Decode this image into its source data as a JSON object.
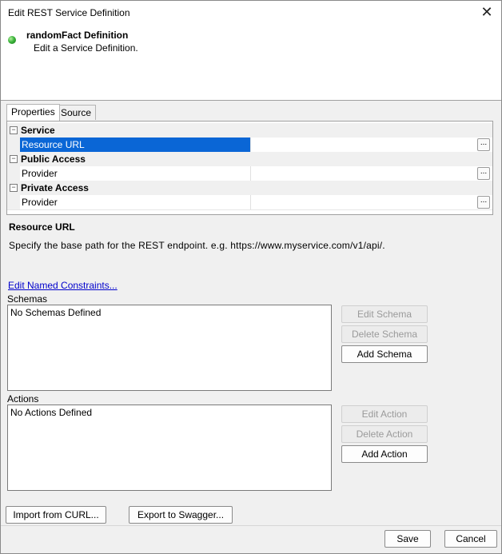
{
  "window": {
    "title": "Edit REST Service Definition",
    "close_glyph": "✕"
  },
  "header": {
    "title": "randomFact Definition",
    "subtitle": "Edit a Service Definition.",
    "status_color": "#3cb43c"
  },
  "tabs": [
    {
      "label": "Properties",
      "active": true
    },
    {
      "label": "Source",
      "active": false
    }
  ],
  "property_grid": {
    "groups": [
      {
        "label": "Service",
        "toggle": "⊟",
        "rows": [
          {
            "name": "Resource URL",
            "value": "",
            "selected": true
          }
        ]
      },
      {
        "label": "Public Access",
        "toggle": "⊟",
        "rows": [
          {
            "name": "Provider",
            "value": "",
            "selected": false
          }
        ]
      },
      {
        "label": "Private Access",
        "toggle": "⊟",
        "rows": [
          {
            "name": "Provider",
            "value": "",
            "selected": false
          }
        ]
      }
    ],
    "ellipsis": "..."
  },
  "description": {
    "title": "Resource URL",
    "text": "Specify the base path for the REST endpoint. e.g. https://www.myservice.com/v1/api/."
  },
  "constraints_link": "Edit Named Constraints...",
  "schemas": {
    "label": "Schemas",
    "empty_text": "No Schemas Defined",
    "edit_label": "Edit Schema",
    "delete_label": "Delete Schema",
    "add_label": "Add Schema"
  },
  "actions": {
    "label": "Actions",
    "empty_text": "No Actions Defined",
    "edit_label": "Edit Action",
    "delete_label": "Delete Action",
    "add_label": "Add Action"
  },
  "bottom_buttons": {
    "import_label": "Import from CURL...",
    "export_label": "Export to Swagger..."
  },
  "footer": {
    "save_label": "Save",
    "cancel_label": "Cancel"
  }
}
